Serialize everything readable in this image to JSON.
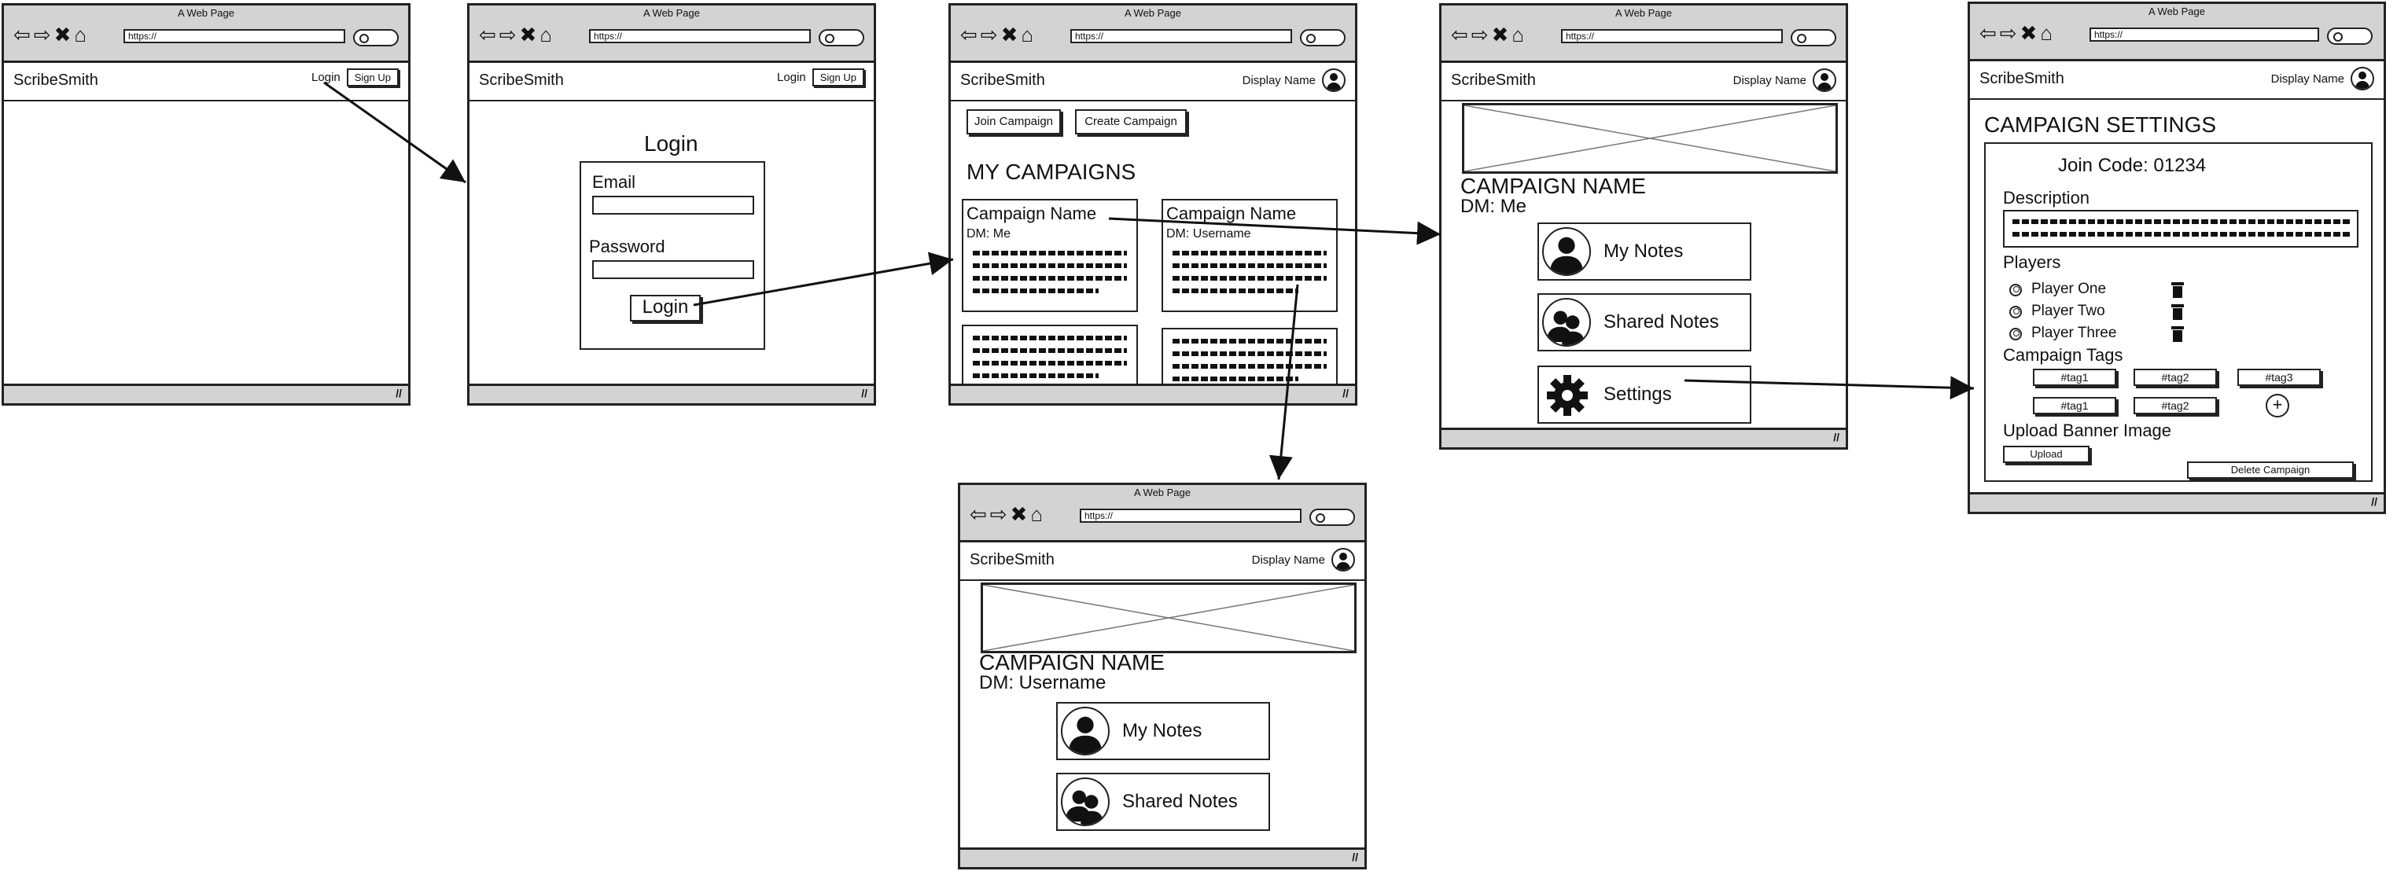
{
  "chrome": {
    "window_title": "A Web Page",
    "url": "https://"
  },
  "app": {
    "brand": "ScribeSmith",
    "display_name": "Display Name"
  },
  "landing": {
    "login_link": "Login",
    "signup_button": "Sign Up"
  },
  "login": {
    "title": "Login",
    "email_label": "Email",
    "password_label": "Password",
    "submit": "Login"
  },
  "dashboard": {
    "join": "Join Campaign",
    "create": "Create Campaign",
    "heading": "MY CAMPAIGNS",
    "cards": [
      {
        "name": "Campaign Name",
        "dm": "DM: Me"
      },
      {
        "name": "Campaign Name",
        "dm": "DM: Username"
      }
    ]
  },
  "campaign_owner": {
    "name": "CAMPAIGN NAME",
    "dm": "DM: Me",
    "tiles": [
      "My Notes",
      "Shared Notes",
      "Settings"
    ]
  },
  "campaign_player": {
    "name": "CAMPAIGN NAME",
    "dm": "DM: Username",
    "tiles": [
      "My Notes",
      "Shared Notes"
    ]
  },
  "settings": {
    "heading": "CAMPAIGN SETTINGS",
    "join_code": "Join Code: 01234",
    "description_label": "Description",
    "players_label": "Players",
    "players": [
      "Player One",
      "Player Two",
      "Player Three"
    ],
    "tags_label": "Campaign Tags",
    "tags": [
      "#tag1",
      "#tag2",
      "#tag3",
      "#tag1",
      "#tag2"
    ],
    "add_tag": "+",
    "banner_label": "Upload Banner Image",
    "upload": "Upload",
    "delete": "Delete Campaign"
  }
}
